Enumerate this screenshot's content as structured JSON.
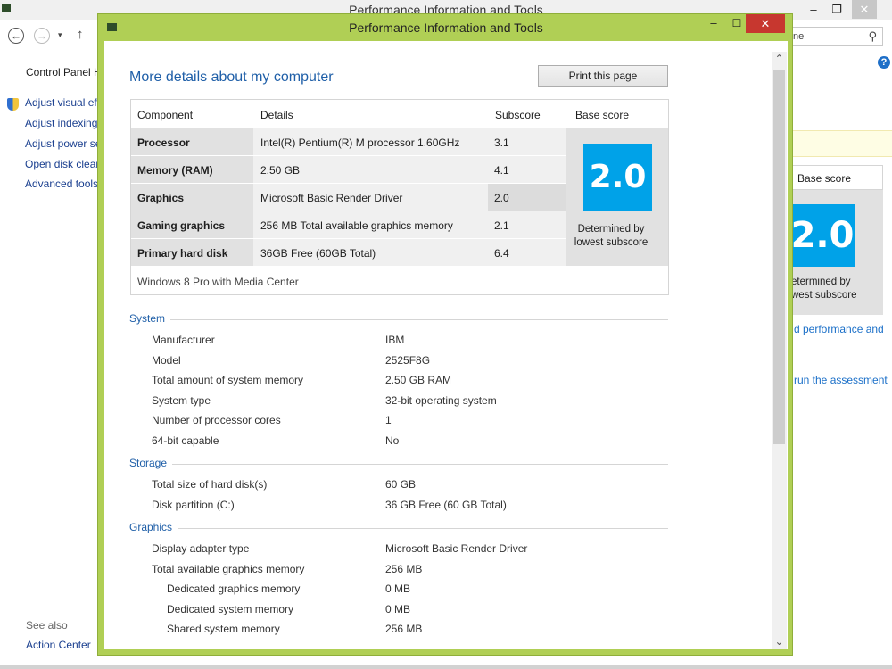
{
  "background_window": {
    "title": "Performance Information and Tools",
    "nav": {
      "back": "←",
      "forward": "→",
      "recent": "▾",
      "up": "↑"
    },
    "search_text": "nel",
    "sidebar": {
      "home_link": "Control Panel H",
      "tasks": [
        "Adjust visual eff",
        "Adjust indexing",
        "Adjust power se",
        "Open disk clean",
        "Advanced tools"
      ],
      "see_also": "See also",
      "action_center": "Action Center"
    },
    "right": {
      "base_score_header": "Base score",
      "score": "2.0",
      "caption_line1": "etermined by",
      "caption_line2": "west subscore",
      "link_1": "d performance and",
      "link_2": "run the assessment"
    },
    "window_controls": {
      "min": "–",
      "max": "❐",
      "close": "✕"
    }
  },
  "dialog": {
    "title": "Performance Information and Tools",
    "window_controls": {
      "min": "–",
      "max": "☐",
      "close": "✕"
    },
    "heading": "More details about my computer",
    "print_button": "Print this page",
    "table": {
      "headers": {
        "component": "Component",
        "details": "Details",
        "subscore": "Subscore",
        "base_score": "Base score"
      },
      "rows": [
        {
          "component": "Processor",
          "details": "Intel(R) Pentium(R) M processor 1.60GHz",
          "subscore": "3.1"
        },
        {
          "component": "Memory (RAM)",
          "details": "2.50 GB",
          "subscore": "4.1"
        },
        {
          "component": "Graphics",
          "details": "Microsoft Basic Render Driver",
          "subscore": "2.0"
        },
        {
          "component": "Gaming graphics",
          "details": "256 MB Total available graphics memory",
          "subscore": "2.1"
        },
        {
          "component": "Primary hard disk",
          "details": "36GB Free (60GB Total)",
          "subscore": "6.4"
        }
      ],
      "base_score": "2.0",
      "base_score_caption_1": "Determined by",
      "base_score_caption_2": "lowest subscore",
      "os_edition": "Windows 8 Pro with Media Center"
    },
    "sections": {
      "system": {
        "title": "System",
        "rows": [
          {
            "label": "Manufacturer",
            "value": "IBM"
          },
          {
            "label": "Model",
            "value": "2525F8G"
          },
          {
            "label": "Total amount of system memory",
            "value": "2.50 GB RAM"
          },
          {
            "label": "System type",
            "value": "32-bit operating system"
          },
          {
            "label": "Number of processor cores",
            "value": "1"
          },
          {
            "label": "64-bit capable",
            "value": "No"
          }
        ]
      },
      "storage": {
        "title": "Storage",
        "rows": [
          {
            "label": "Total size of hard disk(s)",
            "value": "60 GB"
          },
          {
            "label": "Disk partition (C:)",
            "value": "36 GB Free (60 GB Total)"
          }
        ]
      },
      "graphics": {
        "title": "Graphics",
        "rows": [
          {
            "label": "Display adapter type",
            "value": "Microsoft Basic Render Driver"
          },
          {
            "label": "Total available graphics memory",
            "value": "256 MB"
          },
          {
            "label": "Dedicated graphics memory",
            "value": "0 MB"
          },
          {
            "label": "Dedicated system memory",
            "value": "0 MB"
          },
          {
            "label": "Shared system memory",
            "value": "256 MB"
          }
        ]
      }
    },
    "scrollbar": {
      "up": "⌃",
      "down": "⌄"
    }
  },
  "colors": {
    "dialog_frame": "#b0cf55",
    "score_tile": "#00a2e8",
    "close_button": "#c7372f",
    "link": "#1f5fa8"
  }
}
